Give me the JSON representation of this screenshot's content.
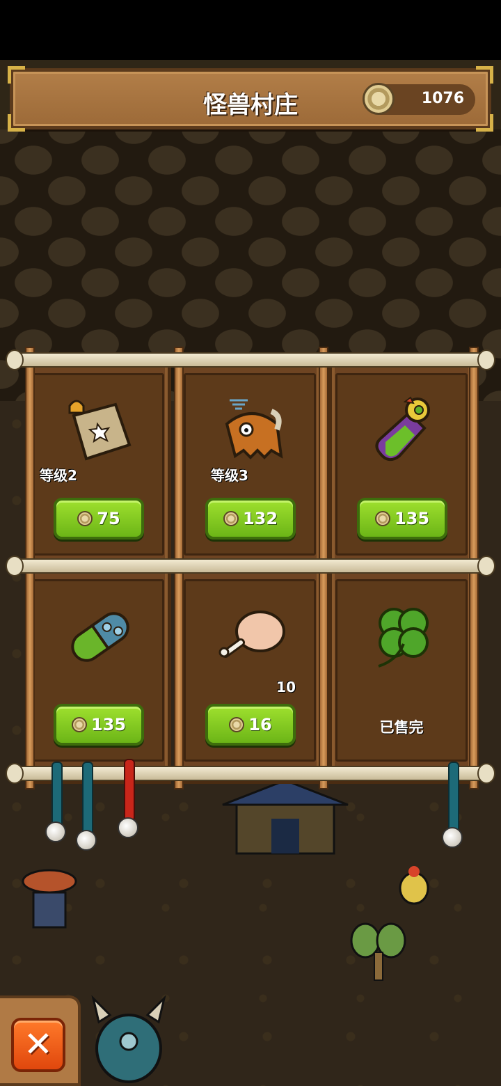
{
  "header": {
    "title": "怪兽村庄",
    "coins": "1076"
  },
  "shop": {
    "slots": [
      {
        "icon": "treasure-map-icon",
        "level": "等级2",
        "price": "75"
      },
      {
        "icon": "yeti-monster-icon",
        "level": "等级3",
        "price": "132"
      },
      {
        "icon": "potion-bottle-icon",
        "price": "135"
      },
      {
        "icon": "capsule-pill-icon",
        "price": "135"
      },
      {
        "icon": "meat-drumstick-icon",
        "quantity": "10",
        "price": "16"
      },
      {
        "icon": "four-leaf-clover-icon",
        "status": "已售完"
      }
    ]
  },
  "colors": {
    "price_button": "#8fd424",
    "close_button": "#f15a18",
    "wood": "#6e4422"
  }
}
